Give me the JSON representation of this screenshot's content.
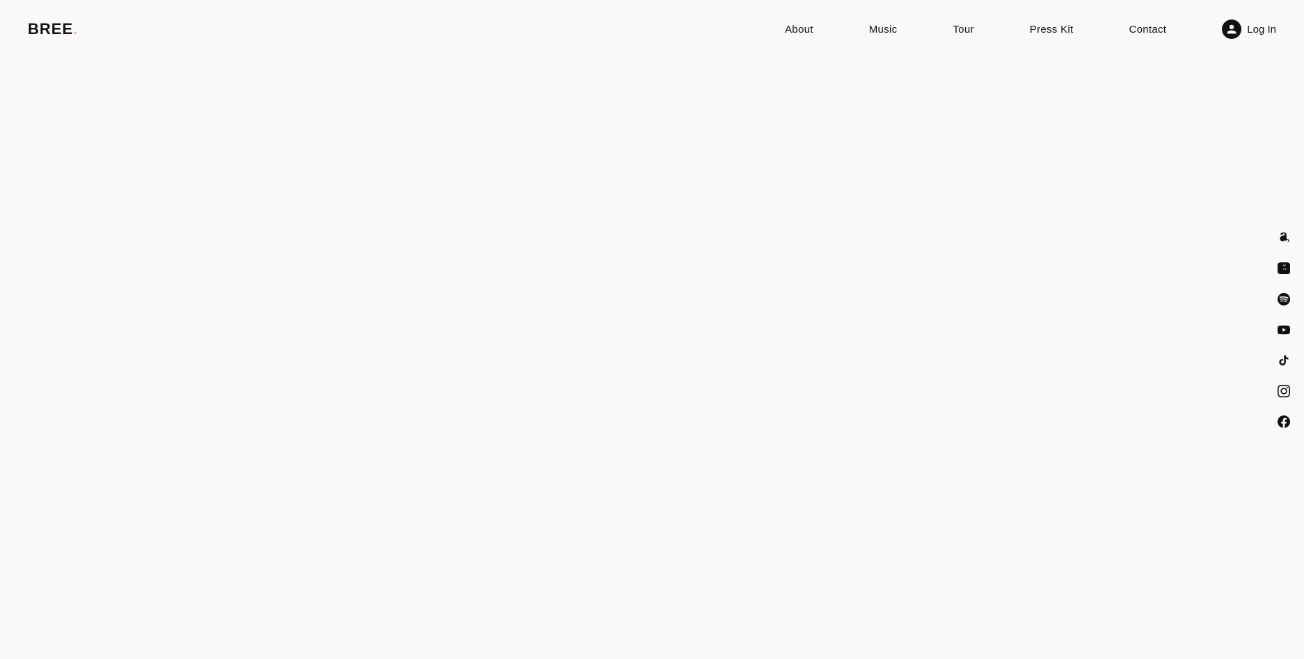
{
  "header": {
    "logo": {
      "text": "BREE",
      "dot": "."
    },
    "nav": {
      "items": [
        {
          "label": "About",
          "id": "about"
        },
        {
          "label": "Music",
          "id": "music"
        },
        {
          "label": "Tour",
          "id": "tour"
        },
        {
          "label": "Press Kit",
          "id": "press-kit"
        },
        {
          "label": "Contact",
          "id": "contact"
        }
      ],
      "login_label": "Log In"
    }
  },
  "social": {
    "items": [
      {
        "id": "amazon",
        "label": "Amazon Music"
      },
      {
        "id": "apple-music",
        "label": "Apple Music"
      },
      {
        "id": "spotify",
        "label": "Spotify"
      },
      {
        "id": "youtube",
        "label": "YouTube"
      },
      {
        "id": "tiktok",
        "label": "TikTok"
      },
      {
        "id": "instagram",
        "label": "Instagram"
      },
      {
        "id": "facebook",
        "label": "Facebook"
      }
    ]
  }
}
